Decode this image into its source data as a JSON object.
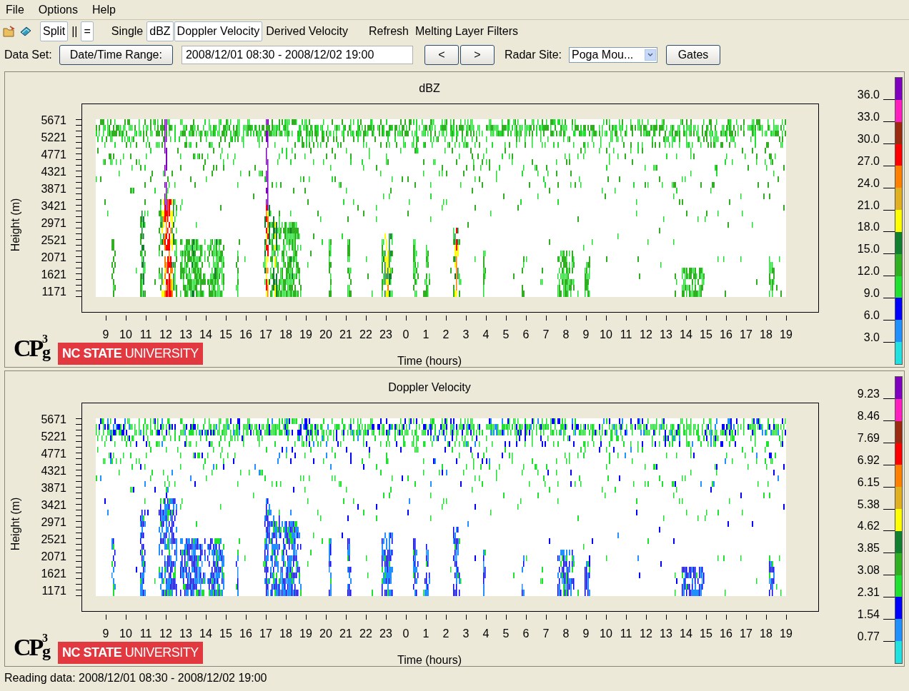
{
  "menu": [
    "File",
    "Options",
    "Help"
  ],
  "toolbar": [
    {
      "label": "Split",
      "selected": true
    },
    {
      "label": "||",
      "selected": false
    },
    {
      "label": "=",
      "selected": true
    },
    {
      "label": "Single",
      "selected": false
    },
    {
      "label": "dBZ",
      "selected": true
    },
    {
      "label": "Doppler Velocity",
      "selected": true
    },
    {
      "label": "Derived Velocity",
      "selected": false
    },
    {
      "label": "Refresh",
      "selected": false
    },
    {
      "label": "Melting Layer Filters",
      "selected": false
    }
  ],
  "data_set": {
    "label": "Data Set:",
    "range_button": "Date/Time Range:",
    "range_value": "2008/12/01 08:30 - 2008/12/02 19:00",
    "prev": "<",
    "next": ">",
    "site_label": "Radar Site:",
    "site_value": "Poga Mou...",
    "gates_button": "Gates"
  },
  "panels": [
    {
      "kind": "dbz",
      "title": "dBZ",
      "ylabel": "Height (m)",
      "xlabel": "Time (hours)",
      "yticks": [
        "5671",
        "5221",
        "4771",
        "4321",
        "3871",
        "3421",
        "2971",
        "2521",
        "2071",
        "1621",
        "1171"
      ],
      "xticks": [
        "9",
        "10",
        "11",
        "12",
        "13",
        "14",
        "15",
        "16",
        "17",
        "18",
        "19",
        "20",
        "21",
        "22",
        "23",
        "0",
        "1",
        "2",
        "3",
        "4",
        "5",
        "6",
        "7",
        "8",
        "9",
        "10",
        "11",
        "12",
        "13",
        "14",
        "15",
        "16",
        "17",
        "18",
        "19"
      ],
      "legend": [
        {
          "color": "#7f00bf",
          "label": "36.0"
        },
        {
          "color": "#ff1fbf",
          "label": "33.0"
        },
        {
          "color": "#9a2a10",
          "label": "30.0"
        },
        {
          "color": "#ff0000",
          "label": "27.0"
        },
        {
          "color": "#ff8000",
          "label": "24.0"
        },
        {
          "color": "#e0b020",
          "label": "21.0"
        },
        {
          "color": "#ffff00",
          "label": "18.0"
        },
        {
          "color": "#108030",
          "label": "15.0"
        },
        {
          "color": "#30b020",
          "label": "12.0"
        },
        {
          "color": "#20e030",
          "label": "9.0"
        },
        {
          "color": "#0000ff",
          "label": "6.0"
        },
        {
          "color": "#2090ff",
          "label": "3.0"
        },
        {
          "color": "#20e0e0"
        }
      ],
      "logo": {
        "main": "CP",
        "sup": "3",
        "sub": "g",
        "university": "**NC STATE** UNIVERSITY"
      }
    },
    {
      "kind": "velocity",
      "title": "Doppler Velocity",
      "ylabel": "Height (m)",
      "xlabel": "Time (hours)",
      "yticks": [
        "5671",
        "5221",
        "4771",
        "4321",
        "3871",
        "3421",
        "2971",
        "2521",
        "2071",
        "1621",
        "1171"
      ],
      "xticks": [
        "9",
        "10",
        "11",
        "12",
        "13",
        "14",
        "15",
        "16",
        "17",
        "18",
        "19",
        "20",
        "21",
        "22",
        "23",
        "0",
        "1",
        "2",
        "3",
        "4",
        "5",
        "6",
        "7",
        "8",
        "9",
        "10",
        "11",
        "12",
        "13",
        "14",
        "15",
        "16",
        "17",
        "18",
        "19"
      ],
      "legend": [
        {
          "color": "#7f00bf",
          "label": "9.23"
        },
        {
          "color": "#ff1fbf",
          "label": "8.46"
        },
        {
          "color": "#9a2a10",
          "label": "7.69"
        },
        {
          "color": "#ff0000",
          "label": "6.92"
        },
        {
          "color": "#ff8000",
          "label": "6.15"
        },
        {
          "color": "#e0b020",
          "label": "5.38"
        },
        {
          "color": "#ffff00",
          "label": "4.62"
        },
        {
          "color": "#108030",
          "label": "3.85"
        },
        {
          "color": "#30b020",
          "label": "3.08"
        },
        {
          "color": "#20e030",
          "label": "2.31"
        },
        {
          "color": "#0000ff",
          "label": "1.54"
        },
        {
          "color": "#2090ff",
          "label": "0.77"
        },
        {
          "color": "#20e0e0"
        }
      ],
      "logo": {
        "main": "CP",
        "sup": "3",
        "sub": "g",
        "university": "**NC STATE** UNIVERSITY"
      }
    }
  ],
  "status_bar": "Reading data: 2008/12/01 08:30 - 2008/12/02 19:00"
}
